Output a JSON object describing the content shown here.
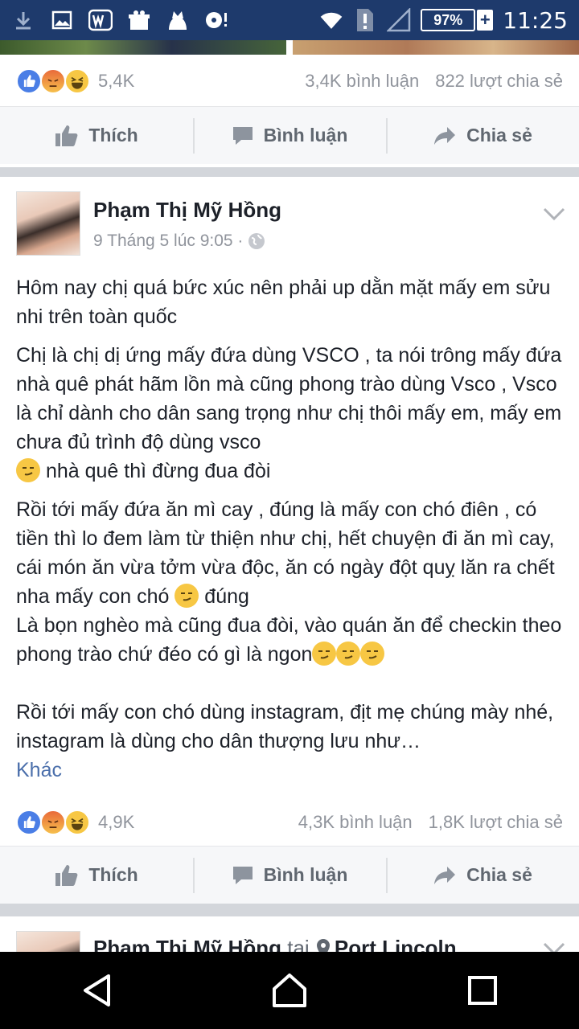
{
  "status_bar": {
    "time": "11:25",
    "battery": "97%",
    "battery_plus": "+",
    "icons": [
      "download-icon",
      "image-icon",
      "word-app-icon",
      "gift-icon",
      "cat-app-icon",
      "record-icon",
      "wifi-icon",
      "alert-sim-icon",
      "signal-icon",
      "battery-icon"
    ]
  },
  "post1": {
    "reaction_count": "5,4K",
    "comments": "3,4K bình luận",
    "shares": "822 lượt chia sẻ"
  },
  "actions": {
    "like": "Thích",
    "comment": "Bình luận",
    "share": "Chia sẻ"
  },
  "post2": {
    "author": "Phạm Thị Mỹ Hồng",
    "timestamp": "9 Tháng 5 lúc 9:05 ·",
    "paragraphs": {
      "p1": "Hôm nay chị quá bức xúc nên phải up dằn mặt mấy em sửu nhi trên toàn quốc",
      "p2": "Chị là chị dị ứng mấy đứa dùng VSCO , ta nói trông mấy đứa nhà quê phát hãm lồn mà cũng phong trào dùng Vsco , Vsco là chỉ dành cho dân sang trọng như chị thôi mấy em, mấy em chưa đủ trình độ dùng vsco",
      "p2_end": " nhà quê thì đừng đua đòi",
      "p3": "Rồi tới mấy đứa ăn mì cay , đúng là mấy con chó điên , có tiền thì lo đem làm từ thiện như chị, hết chuyện đi ăn mì cay, cái món ăn vừa tởm vừa độc, ăn có ngày đột quỵ lăn ra chết nha mấy con chó ",
      "p3_end": " đúng",
      "p4": "Là bọn nghèo mà cũng đua đòi, vào quán ăn để checkin theo phong trào chứ đéo có gì là ngon",
      "p5": "Rồi tới mấy con chó dùng instagram, địt mẹ chúng mày nhé, instagram là dùng cho dân thượng lưu như…",
      "more": "Khác"
    },
    "reaction_count": "4,9K",
    "comments": "4,3K bình luận",
    "shares": "1,8K lượt chia sẻ"
  },
  "post3": {
    "author": "Phạm Thị Mỹ Hồng",
    "connector": " tại ",
    "place": "Port Lincoln"
  }
}
